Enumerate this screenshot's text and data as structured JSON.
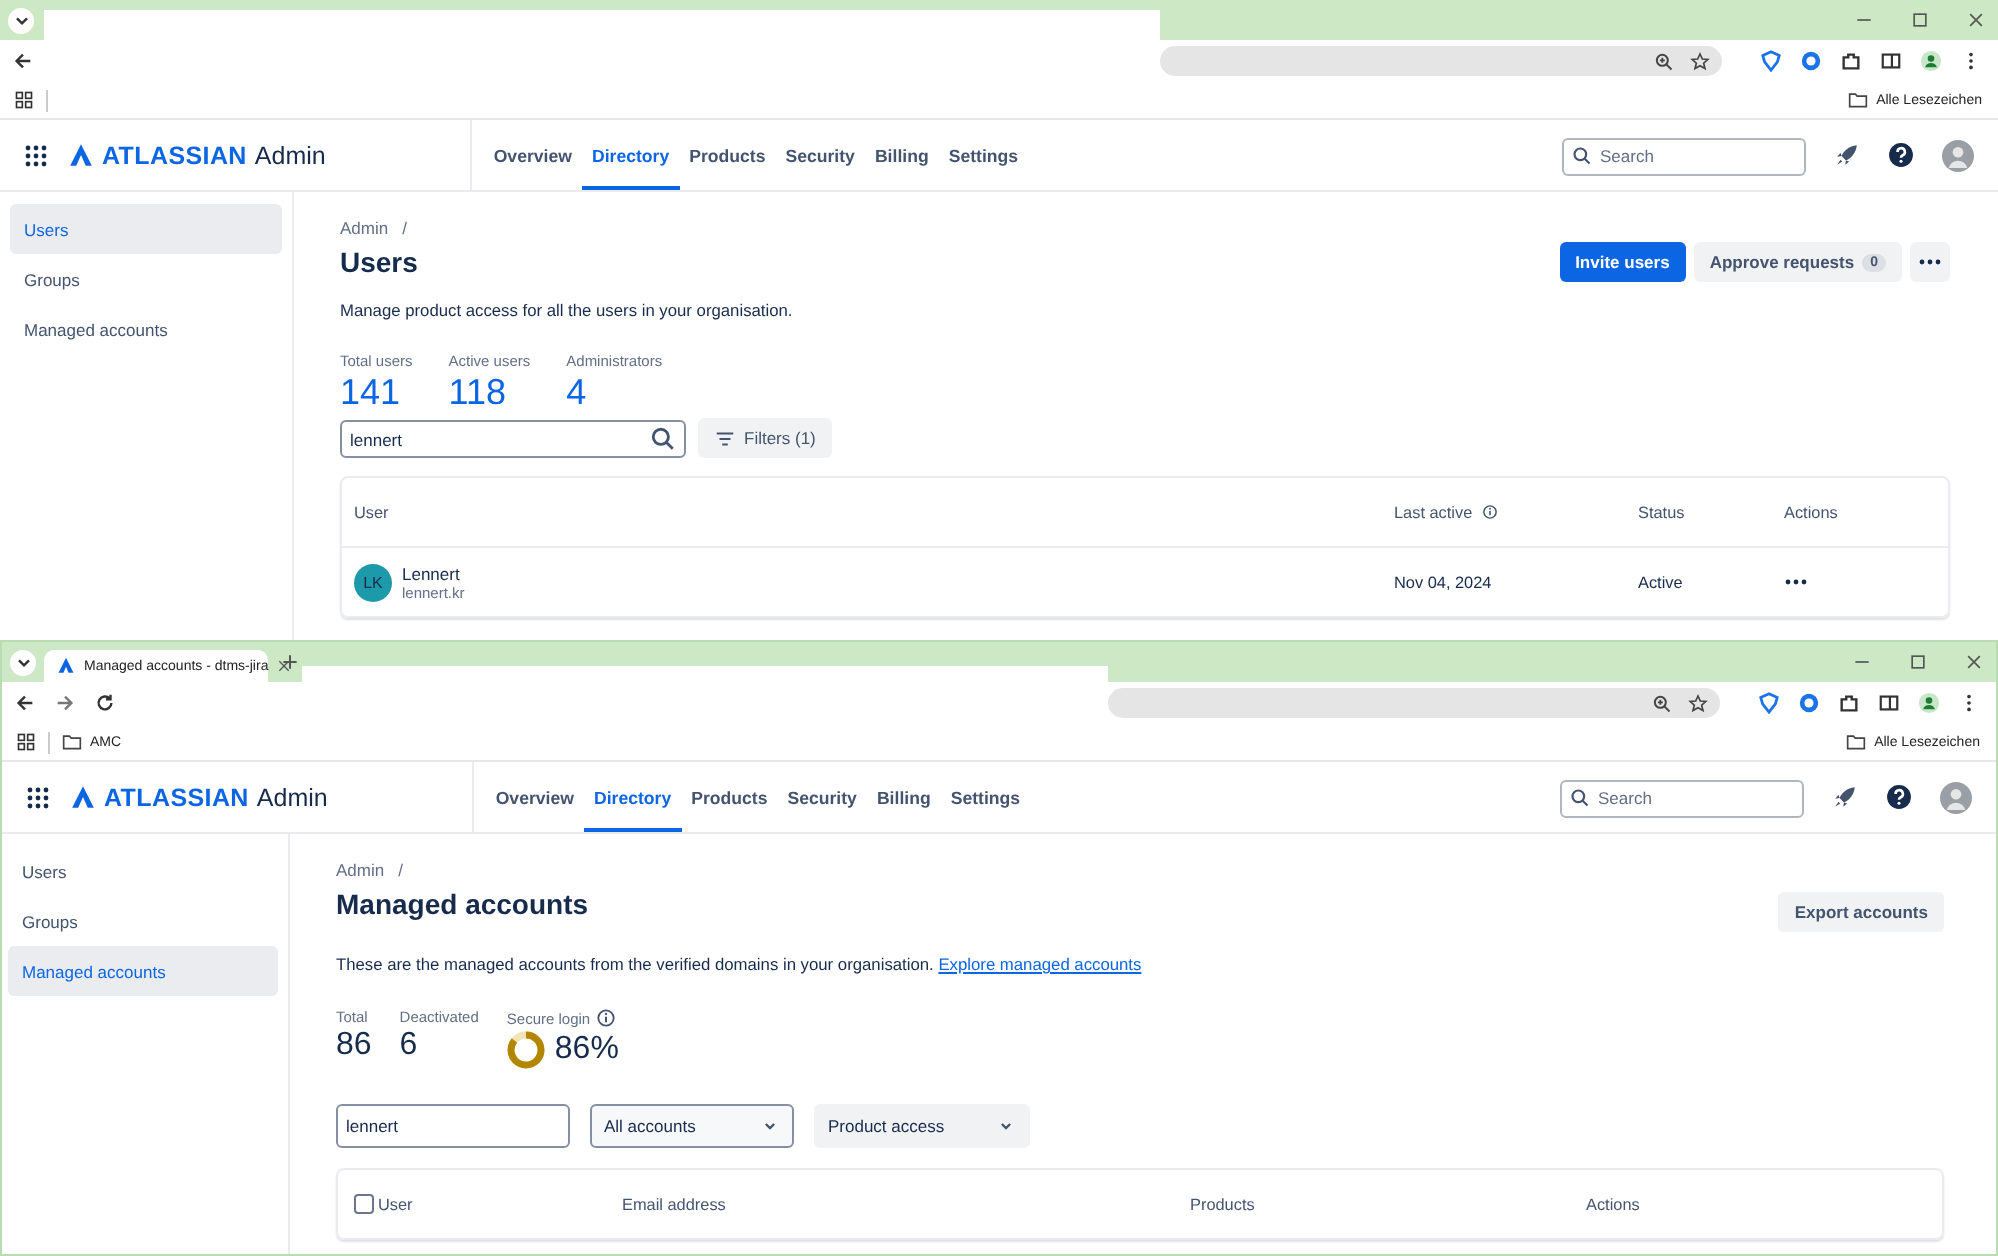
{
  "windows": [
    {
      "bookmarks_folder": "Alle Lesezeichen",
      "app": {
        "logo": "ATLASSIAN",
        "product": "Admin",
        "nav": [
          {
            "label": "Overview",
            "selected": false
          },
          {
            "label": "Directory",
            "selected": true
          },
          {
            "label": "Products",
            "selected": false
          },
          {
            "label": "Security",
            "selected": false
          },
          {
            "label": "Billing",
            "selected": false
          },
          {
            "label": "Settings",
            "selected": false
          }
        ],
        "search": {
          "placeholder": "Search"
        },
        "sidebar": [
          {
            "label": "Users",
            "selected": true
          },
          {
            "label": "Groups",
            "selected": false
          },
          {
            "label": "Managed accounts",
            "selected": false
          }
        ],
        "page": {
          "kind": "users",
          "breadcrumb": "Admin",
          "separator": "/",
          "title": "Users",
          "actions": [
            {
              "kind": "primary",
              "label": "Invite users"
            },
            {
              "kind": "badge",
              "label": "Approve requests",
              "badge": "0"
            },
            {
              "kind": "more"
            }
          ],
          "description": "Manage product access for all the users in your organisation.",
          "stats": [
            {
              "label": "Total users",
              "value": "141"
            },
            {
              "label": "Active users",
              "value": "118"
            },
            {
              "label": "Administrators",
              "value": "4"
            }
          ],
          "search_value": "lennert",
          "filter_button": "Filters (1)",
          "columns": [
            {
              "label": "User"
            },
            {
              "label": "Last active",
              "info": true
            },
            {
              "label": "Status"
            },
            {
              "label": "Actions"
            }
          ],
          "rows": [
            {
              "initials": "LK",
              "name": "Lennert",
              "username": "lennert.kr",
              "last_active": "Nov 04, 2024",
              "status": "Active"
            }
          ]
        }
      }
    },
    {
      "tab": "Managed accounts - dtms-jira",
      "bookmarks": [
        "AMC"
      ],
      "bookmarks_folder": "Alle Lesezeichen",
      "app": {
        "logo": "ATLASSIAN",
        "product": "Admin",
        "nav": [
          {
            "label": "Overview",
            "selected": false
          },
          {
            "label": "Directory",
            "selected": true
          },
          {
            "label": "Products",
            "selected": false
          },
          {
            "label": "Security",
            "selected": false
          },
          {
            "label": "Billing",
            "selected": false
          },
          {
            "label": "Settings",
            "selected": false
          }
        ],
        "search": {
          "placeholder": "Search"
        },
        "sidebar": [
          {
            "label": "Users",
            "selected": false
          },
          {
            "label": "Groups",
            "selected": false
          },
          {
            "label": "Managed accounts",
            "selected": true
          }
        ],
        "page": {
          "kind": "managed_accounts",
          "breadcrumb": "Admin",
          "separator": "/",
          "title": "Managed accounts",
          "actions": [
            {
              "kind": "default",
              "label": "Export accounts"
            }
          ],
          "description": "These are the managed accounts from the verified domains in your organisation.",
          "link": "Explore managed accounts",
          "stats": [
            {
              "label": "Total",
              "value": "86"
            },
            {
              "label": "Deactivated",
              "value": "6"
            },
            {
              "label": "Secure login",
              "value": "86%",
              "info": true,
              "level": 0.86
            }
          ],
          "search_value": "lennert",
          "filters": [
            "All accounts",
            "Product access"
          ],
          "select_all": {
            "checked": false
          },
          "columns": [
            {
              "label": "User"
            },
            {
              "label": "Email address"
            },
            {
              "label": "Products"
            },
            {
              "label": "Actions"
            }
          ]
        }
      }
    }
  ]
}
